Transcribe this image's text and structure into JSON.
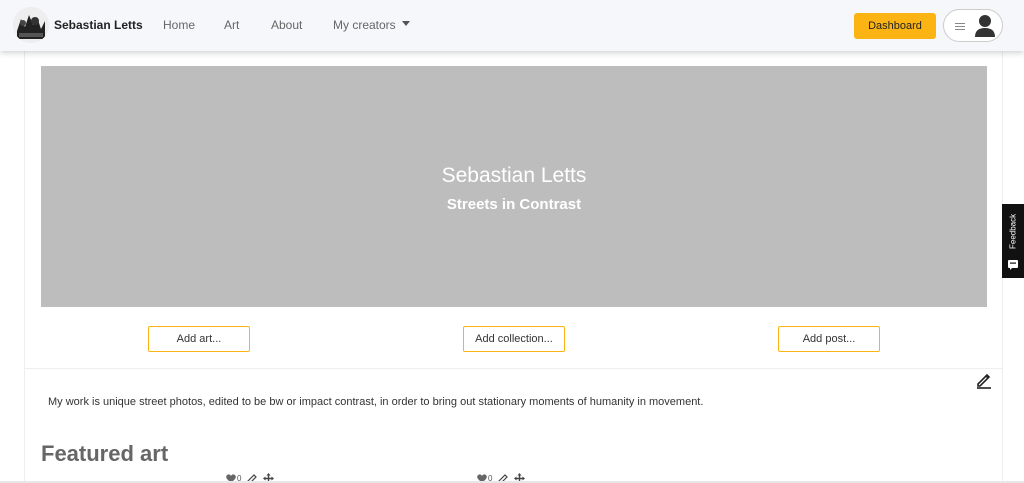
{
  "nav": {
    "brand": "Sebastian Letts",
    "links": [
      "Home",
      "Art",
      "About",
      "My creators"
    ],
    "dashboard": "Dashboard"
  },
  "banner": {
    "title": "Sebastian Letts",
    "subtitle": "Streets in Contrast"
  },
  "actions": {
    "add_art": "Add art...",
    "add_collection": "Add collection...",
    "add_post": "Add post..."
  },
  "bio": "My work is unique street photos, edited to be bw or impact contrast, in order to bring out stationary moments of humanity in movement.",
  "featured": {
    "title": "Featured art",
    "items": [
      {
        "likes": "0"
      },
      {
        "likes": "0"
      }
    ]
  },
  "feedback": "Feedback",
  "colors": {
    "accent": "#fcb415",
    "banner_bg": "#bdbdbd",
    "navbar_bg": "#f5f7fa"
  },
  "icons": [
    "hamburger-icon",
    "user-icon",
    "caret-down-icon",
    "pencil-icon",
    "heart-icon",
    "move-icon",
    "chat-icon"
  ]
}
